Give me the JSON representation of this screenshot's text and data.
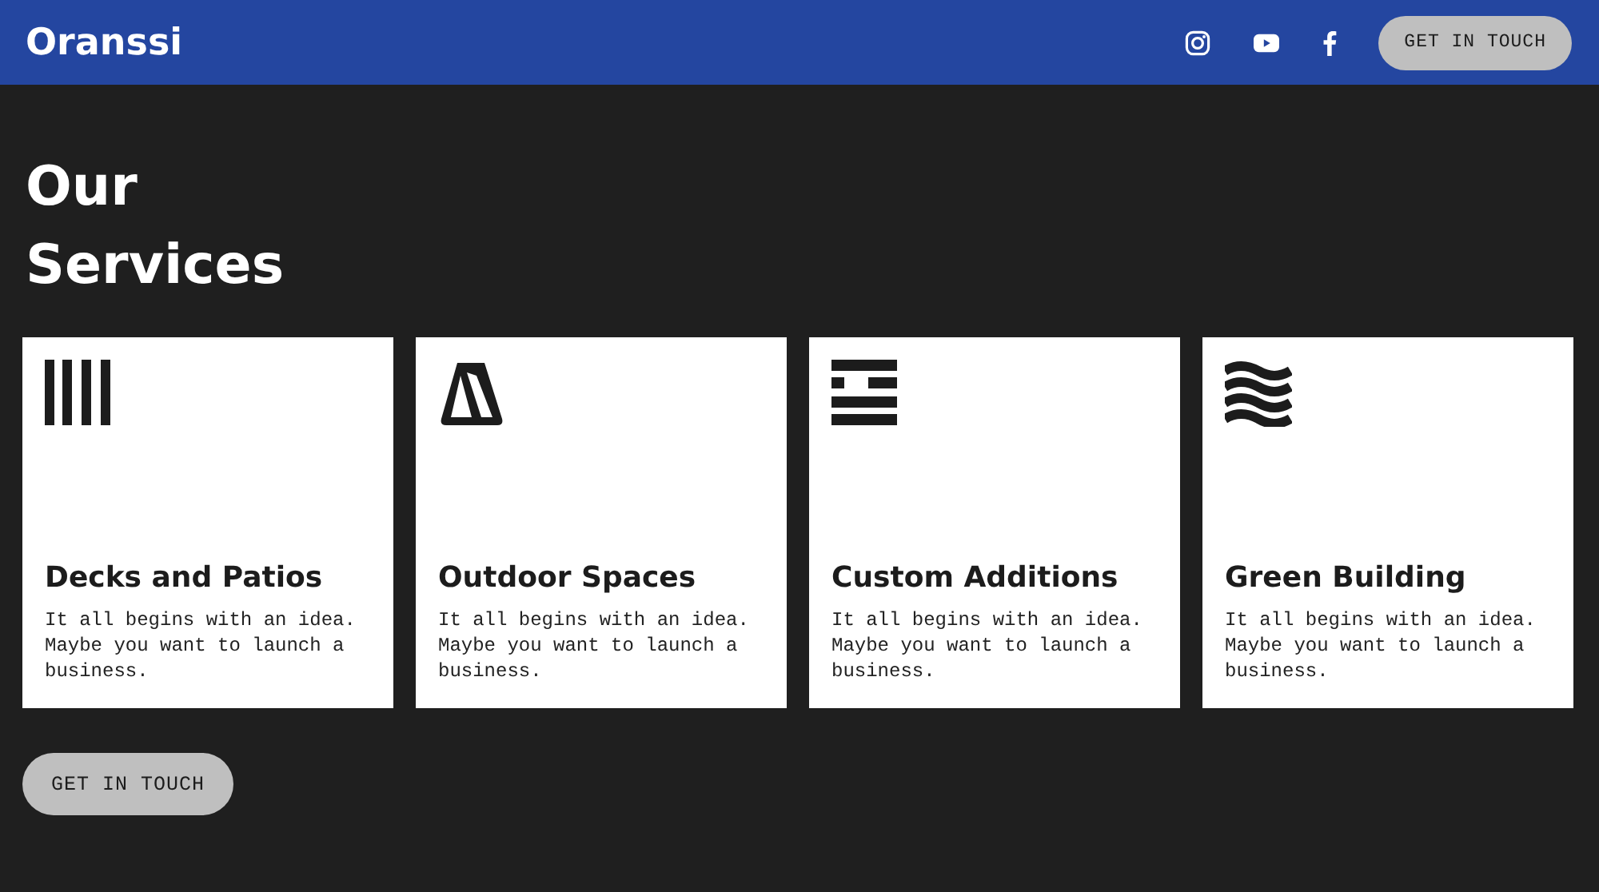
{
  "header": {
    "logo": "Oranssi",
    "social": [
      {
        "kind": "instagram"
      },
      {
        "kind": "youtube"
      },
      {
        "kind": "facebook"
      }
    ],
    "button": "GET IN TOUCH"
  },
  "section": {
    "title": "Our Services",
    "cards": [
      {
        "kind": "bars",
        "title": "Decks and Patios",
        "text": "It all begins with an idea. Maybe you want to launch a business."
      },
      {
        "kind": "tent",
        "title": "Outdoor Spaces",
        "text": "It all begins with an idea. Maybe you want to launch a business."
      },
      {
        "kind": "lines",
        "title": "Custom Additions",
        "text": "It all begins with an idea. Maybe you want to launch a business."
      },
      {
        "kind": "waves",
        "title": "Green Building",
        "text": "It all begins with an idea. Maybe you want to launch a business."
      }
    ],
    "button": "GET IN TOUCH"
  }
}
